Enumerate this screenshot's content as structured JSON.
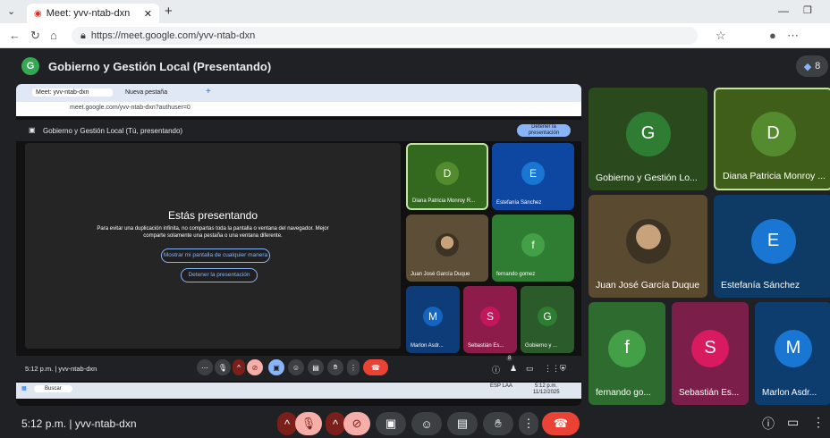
{
  "browser": {
    "tab_title": "Meet: yvv-ntab-dxn",
    "url": "https://meet.google.com/yvv-ntab-dxn"
  },
  "meet": {
    "header_title": "Gobierno y Gestión Local (Presentando)",
    "badge_letter": "G",
    "participant_count": "8",
    "time_meeting": "5:12 p.m.  |  yvv-ntab-dxn"
  },
  "inner": {
    "tab1": "Meet: yvv-ntab-dxn",
    "tab2": "Nueva pestaña",
    "url": "meet.google.com/yvv-ntab-dxn?authuser=0",
    "header": "Gobierno y Gestión Local (Tú, presentando)",
    "stop_button": "Detener la presentación",
    "presenting_title": "Estás presentando",
    "presenting_msg": "Para evitar una duplicación infinita, no compartas toda la pantalla o ventana del navegador. Mejor comparte solamente una pestaña o una ventana diferente.",
    "show_anyway": "Mostrar mi pantalla de cualquier manera",
    "stop_presenting": "Detener la presentación",
    "time_meeting": "5:12 p.m.  |  yvv-ntab-dxn",
    "search": "Buscar",
    "tray_lang": "ESP LAA",
    "tray_time": "5:12 p.m.",
    "tray_date": "11/12/2025",
    "badge_count": "8"
  },
  "inner_tiles": [
    {
      "name": "Diana Patricia Monroy R...",
      "letter": "D",
      "color": "#558b2f",
      "bg": "#33691e"
    },
    {
      "name": "Estefanía Sánchez",
      "letter": "E",
      "color": "#1976d2",
      "bg": "#0d47a1"
    },
    {
      "name": "Juan José García Duque",
      "letter": "",
      "color": "#6d5a3a",
      "bg": "#5d4e37"
    },
    {
      "name": "fernando gomez",
      "letter": "f",
      "color": "#43a047",
      "bg": "#2e7d32"
    },
    {
      "name": "Marlon Asdr...",
      "letter": "M",
      "color": "#1565c0",
      "bg": "#0d3c78"
    },
    {
      "name": "Sebastián Es...",
      "letter": "S",
      "color": "#c2185b",
      "bg": "#8e1c4b"
    },
    {
      "name": "Gobierno y ...",
      "letter": "G",
      "color": "#2e7d32",
      "bg": "#2b5a2b"
    }
  ],
  "big_tiles": [
    {
      "name": "Gobierno y Gestión Lo...",
      "letter": "G",
      "color": "#2e7d32",
      "bg": "#2a4a1e"
    },
    {
      "name": "Diana Patricia Monroy ...",
      "letter": "D",
      "color": "#558b2f",
      "bg": "#3f5e1a"
    },
    {
      "name": "Juan José García Duque",
      "letter": "",
      "color": "#6d5a3a",
      "bg": "#5a4a30"
    },
    {
      "name": "Estefanía Sánchez",
      "letter": "E",
      "color": "#1976d2",
      "bg": "#0e3a66"
    },
    {
      "name": "fernando go...",
      "letter": "f",
      "color": "#43a047",
      "bg": "#2e6b2e"
    },
    {
      "name": "Sebastián Es...",
      "letter": "S",
      "color": "#d81b60",
      "bg": "#7b1e4a"
    },
    {
      "name": "Marlon Asdr...",
      "letter": "M",
      "color": "#1976d2",
      "bg": "#0d3c6e"
    }
  ]
}
